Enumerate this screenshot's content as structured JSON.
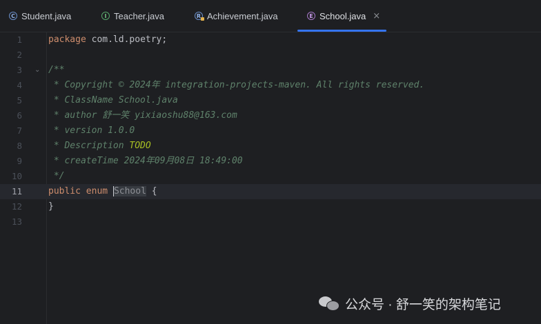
{
  "tabs": [
    {
      "label": "Student.java",
      "icon": "class-icon",
      "icon_glyph": "C",
      "active": false
    },
    {
      "label": "Teacher.java",
      "icon": "interface-icon",
      "icon_glyph": "I",
      "active": false
    },
    {
      "label": "Achievement.java",
      "icon": "record-icon",
      "icon_glyph": "R",
      "active": false
    },
    {
      "label": "School.java",
      "icon": "enum-icon",
      "icon_glyph": "E",
      "active": true,
      "close": "×"
    }
  ],
  "editor": {
    "current_line": 11,
    "lines": [
      {
        "num": "1"
      },
      {
        "num": "2"
      },
      {
        "num": "3"
      },
      {
        "num": "4"
      },
      {
        "num": "5"
      },
      {
        "num": "6"
      },
      {
        "num": "7"
      },
      {
        "num": "8"
      },
      {
        "num": "9"
      },
      {
        "num": "10"
      },
      {
        "num": "11"
      },
      {
        "num": "12"
      },
      {
        "num": "13"
      }
    ],
    "code": {
      "l1_kw": "package",
      "l1_rest": " com.ld.poetry;",
      "l3": "/**",
      "l4": " * Copyright © 2024年 integration-projects-maven. All rights reserved.",
      "l5": " * ClassName School.java",
      "l6": " * author 舒一笑 yixiaoshu88@163.com",
      "l7": " * version 1.0.0",
      "l8_pre": " * Description ",
      "l8_todo": "TODO",
      "l9": " * createTime 2024年09月08日 18:49:00",
      "l10": " */",
      "l11_kw1": "public",
      "l11_kw2": "enum",
      "l11_name": "School",
      "l11_brace": " {",
      "l12": "}"
    },
    "fold_glyph": "⌄"
  },
  "watermark": {
    "text": "公众号 · 舒一笑的架构笔记",
    "icon": "wechat-icon"
  },
  "colors": {
    "background": "#1e1f22",
    "keyword": "#cf8e6d",
    "comment": "#5f826b",
    "todo": "#a8c023",
    "tab_accent": "#3574f0"
  }
}
